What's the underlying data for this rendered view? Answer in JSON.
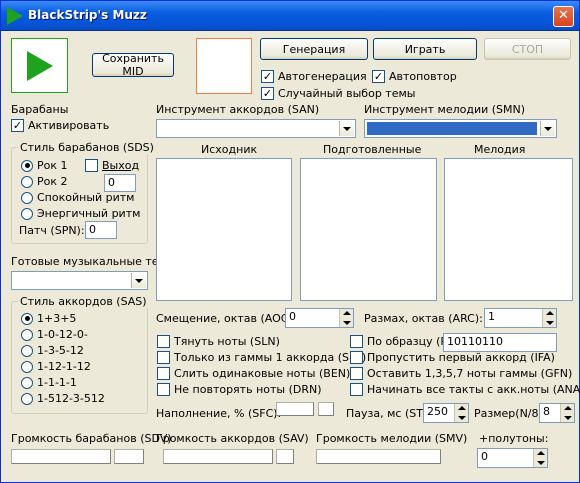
{
  "window": {
    "title": "BlackStrip's Muzz",
    "close": "✕"
  },
  "top": {
    "save_mid": "Сохранить MID",
    "generate": "Генерация",
    "play": "Играть",
    "stop": "СТОП",
    "auto_gen": "Автогенерация",
    "auto_repeat": "Автоповтор",
    "random_theme": "Случайный выбор темы"
  },
  "drums": {
    "title": "Барабаны",
    "activate": "Активировать",
    "style_title": "Стиль барабанов (SDS)",
    "rock1": "Рок 1",
    "rock2": "Рок 2",
    "exit": "Выход",
    "exit_value": "0",
    "calm": "Спокойный ритм",
    "energetic": "Энергичный ритм",
    "patch_label": "Патч (SPN):",
    "patch_value": "0"
  },
  "themes": {
    "label": "Готовые музыкальные темы",
    "value": ""
  },
  "chords": {
    "title": "Стиль аккордов (SAS)",
    "options": [
      "1+3+5",
      "1-0-12-0-",
      "1-3-5-12",
      "1-12-1-12",
      "1-1-1-1",
      "1-512-3-512"
    ]
  },
  "instruments": {
    "chord_label": "Инструмент аккордов (SAN)",
    "chord_value": "",
    "melody_label": "Инструмент мелодии (SMN)",
    "melody_value": ""
  },
  "lists": {
    "source": "Исходник",
    "prepared": "Подготовленные",
    "melody": "Мелодия"
  },
  "params": {
    "offset_label": "Смещение, октав (AOC):",
    "offset_value": "0",
    "range_label": "Размах, октав (ARC):",
    "range_value": "1",
    "pull_notes": "Тянуть ноты (SLN)",
    "by_pattern": "По образцу (P):",
    "pattern_value": "10110110",
    "only_scale": "Только из гаммы 1 аккорда (SFA)",
    "skip_first": "Пропустить первый аккорд (IFA)",
    "merge_same": "Слить одинаковые ноты (BEN)",
    "keep_1357": "Оставить 1,3,5,7 ноты гаммы (GFN)",
    "no_repeat": "Не повторять ноты (DRN)",
    "start_bars": "Начинать все такты с акк.ноты (ANA)",
    "fill_label": "Наполнение, % (SFC):",
    "pause_label": "Пауза, мс (ST):",
    "pause_value": "250",
    "size_label": "Размер(N/8):",
    "size_value": "8"
  },
  "volumes": {
    "drums": "Громкость барабанов (SDV)",
    "chords": "Громкость аккордов (SAV)",
    "melody": "Громкость мелодии (SMV)",
    "semitones": "+полутоны:",
    "semitones_value": "0"
  },
  "colors": {
    "accent": "#316ac5",
    "play_green": "#1ea31e"
  }
}
